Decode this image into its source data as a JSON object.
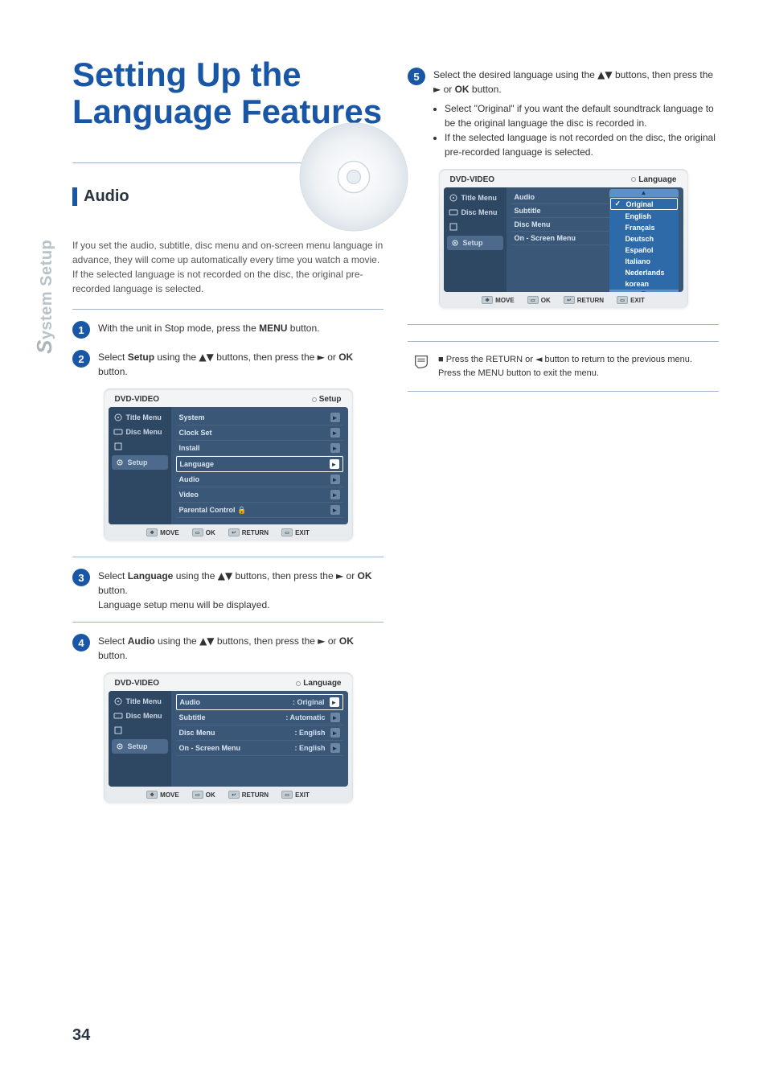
{
  "page_number": "34",
  "side_tab_s": "S",
  "side_tab_rest": "ystem Setup",
  "title_line1": "Setting Up the",
  "title_line2": "Language Features",
  "section_audio": "Audio",
  "intro_text": "If you set the audio, subtitle, disc menu and on-screen menu language in advance, they will come up automatically every time you watch a movie. If the selected language is not recorded on the disc, the original pre-recorded language is selected.",
  "steps": {
    "s1a": "With the unit in Stop mode, press the ",
    "s1b": "MENU",
    "s1c": " button.",
    "s2a": "Select ",
    "s2b": "Setup",
    "s2c": " using the ",
    "s2d": " buttons, then press the ",
    "s2e": " or ",
    "s2f": "OK",
    "s2g": " button.",
    "s3a": "Select ",
    "s3b": "Language",
    "s3c": " using the ",
    "s3d": " buttons, then press the ",
    "s3e": " or ",
    "s3f": "OK",
    "s3g": " button.",
    "s3h": "Language setup menu will be displayed.",
    "s4a": "Select ",
    "s4b": "Audio",
    "s4c": " using the ",
    "s4d": " buttons, then press the ",
    "s4e": " or ",
    "s4f": "OK",
    "s4g": " button.",
    "s5a": "Select the desired language using the ",
    "s5b": " buttons, then press the ",
    "s5c": " or ",
    "s5d": "OK",
    "s5e": " button.",
    "s5f": "Select \"Original\" if you want the default soundtrack language to be the original language the disc is recorded in.",
    "s5g": "If the selected language is not recorded on the disc, the original pre-recorded language is selected."
  },
  "glyph_updown": "▲▼",
  "glyph_right": "►",
  "glyph_left": "◄",
  "note_bullet": "■",
  "note_a": "Press the RETURN or ",
  "note_b": " button to return to the previous menu. Press the MENU button to exit the menu.",
  "osd": {
    "brand": "DVD-VIDEO",
    "head_setup": "Setup",
    "head_language": "Language",
    "side": {
      "title_menu": "Title Menu",
      "disc_menu": "Disc Menu",
      "setup": "Setup"
    },
    "setup_rows": [
      "System",
      "Clock Set",
      "Install",
      "Language",
      "Audio",
      "Video",
      "Parental Control"
    ],
    "lang_rows": [
      {
        "label": "Audio",
        "value": ": Original"
      },
      {
        "label": "Subtitle",
        "value": ": Automatic"
      },
      {
        "label": "Disc Menu",
        "value": ": English"
      },
      {
        "label": "On - Screen Menu",
        "value": ": English"
      }
    ],
    "drop_rows_labels": [
      "Audio",
      "Subtitle",
      "Disc Menu",
      "On - Screen Menu"
    ],
    "drop_options": [
      "Original",
      "English",
      "Français",
      "Deutsch",
      "Español",
      "Italiano",
      "Nederlands",
      "korean"
    ],
    "footer": {
      "move": "MOVE",
      "ok": "OK",
      "return": "RETURN",
      "exit": "EXIT"
    }
  }
}
